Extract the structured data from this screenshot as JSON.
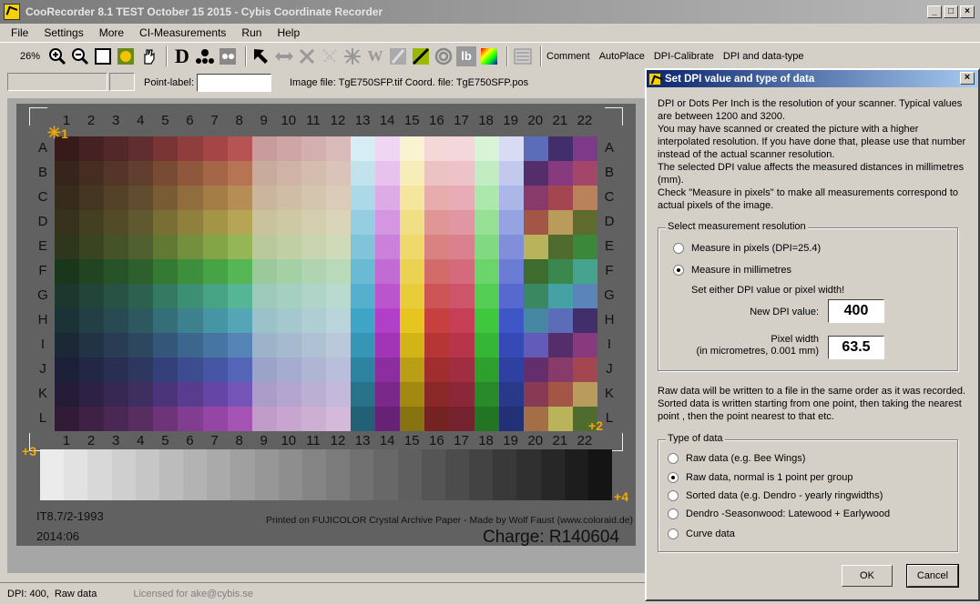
{
  "window": {
    "title": "CooRecorder 8.1 TEST October 15 2015 - Cybis Coordinate Recorder",
    "buttons": [
      "_",
      "□",
      "×"
    ]
  },
  "menu": [
    "File",
    "Settings",
    "More",
    "CI-Measurements",
    "Run",
    "Help"
  ],
  "toolbar": {
    "zoom": "26%",
    "icons": [
      "zoom-in-icon",
      "zoom-out-icon",
      "square-icon",
      "grid-icon",
      "hand-icon",
      "d-icon",
      "dots-icon",
      "dots-dark-icon",
      "arrow-icon",
      "double-arrow-icon",
      "x-icon",
      "x-dotted-icon",
      "asterisk-icon",
      "w-icon",
      "brush-icon",
      "diagonal-icon",
      "target-icon",
      "lb-icon",
      "color-icon",
      "notes-icon"
    ],
    "icon_glyphs": {
      "d": "D",
      "w": "W",
      "lb": "lb"
    },
    "links": [
      "Comment",
      "AutoPlace",
      "DPI-Calibrate",
      "DPI and data-type"
    ]
  },
  "pointbar": {
    "label": "Point-label:",
    "value": "",
    "image_info": "Image file: TgE750SFP.tif  Coord. file: TgE750SFP.pos"
  },
  "chart_image": {
    "numbers": [
      "1",
      "2",
      "3",
      "4",
      "5",
      "6",
      "7",
      "8",
      "9",
      "10",
      "11",
      "12",
      "13",
      "14",
      "15",
      "16",
      "17",
      "18",
      "19",
      "20",
      "21",
      "22"
    ],
    "letters": [
      "A",
      "B",
      "C",
      "D",
      "E",
      "F",
      "G",
      "H",
      "I",
      "J",
      "K",
      "L"
    ],
    "footer_code": "IT8.7/2-1993",
    "footer_year": "2014:06",
    "footer_print": "Printed on FUJICOLOR Crystal Archive Paper  -  Made by Wolf Faust (www.coloraid.de)",
    "footer_charge": "Charge: R140604",
    "markers": [
      "1",
      "2",
      "3",
      "4"
    ]
  },
  "status": {
    "dpi": "DPI: 400,",
    "mode": "Raw data",
    "license": "Licensed for ake@cybis.se"
  },
  "dialog": {
    "title": "Set DPI value and type of data",
    "close": "×",
    "intro": [
      "DPI or Dots Per Inch is the resolution of your scanner. Typical values are between 1200 and 3200.",
      "You may have scanned or created the picture with a higher interpolated resolution. If you have done that, please use that number instead of the actual scanner resolution.",
      "The selected DPI value affects the measured distances in millimetres (mm).",
      "Check \"Measure in pixels\" to make all measurements correspond to actual pixels of the image."
    ],
    "resolution": {
      "title": "Select measurement resolution",
      "opt_pixels": "Measure in pixels (DPI=25.4)",
      "opt_mm": "Measure in millimetres",
      "hint": "Set either DPI value or pixel width!",
      "dpi_label": "New DPI value:",
      "dpi_value": "400",
      "pw_label_1": "Pixel width",
      "pw_label_2": "(in micrometres, 0.001 mm)",
      "pw_value": "63.5",
      "selected": "mm"
    },
    "raw_text": "Raw data will be written to a file in the same order as it was recorded. Sorted data is written starting from one point, then taking the nearest point , then the point nearest to that etc.",
    "datatype": {
      "title": "Type of data",
      "options": [
        "Raw data (e.g. Bee Wings)",
        "Raw data, normal is 1 point per group",
        "Sorted data (e.g. Dendro - yearly ringwidths)",
        "Dendro -Seasonwood: Latewood + Earlywood",
        "Curve data"
      ],
      "selected_index": 1
    },
    "ok": "OK",
    "cancel": "Cancel"
  }
}
